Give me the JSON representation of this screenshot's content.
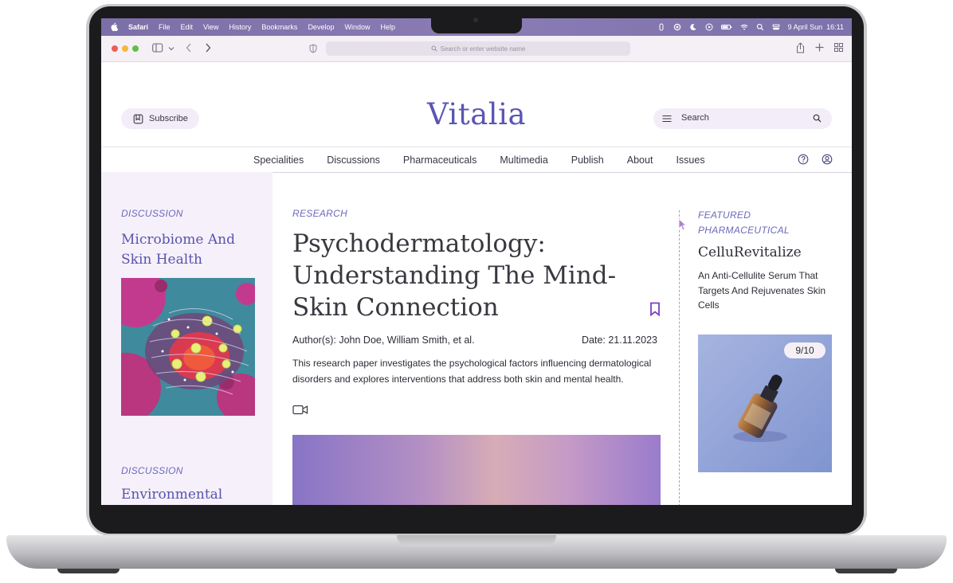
{
  "menubar": {
    "app": "Safari",
    "items": [
      "File",
      "Edit",
      "View",
      "History",
      "Bookmarks",
      "Develop",
      "Window",
      "Help"
    ],
    "datetime": "9 April Sun  16:11"
  },
  "toolbar": {
    "url_placeholder": "Search or enter website name"
  },
  "site": {
    "subscribe_label": "Subscribe",
    "logo": "Vitalia",
    "search_placeholder": "Search"
  },
  "nav": {
    "items": [
      "Specialities",
      "Discussions",
      "Pharmaceuticals",
      "Multimedia",
      "Publish",
      "About",
      "Issues"
    ]
  },
  "left": {
    "card1": {
      "category": "DISCUSSION",
      "title_line1": "Microbiome And",
      "title_line2": "Skin Health"
    },
    "card2": {
      "category": "DISCUSSION",
      "title": "Environmental"
    }
  },
  "article": {
    "category": "RESEARCH",
    "title_line1": "Psychodermatology:",
    "title_line2": "Understanding The Mind-",
    "title_line3": "Skin Connection",
    "authors": "Author(s): John Doe, William Smith, et al.",
    "date": "Date: 21.11.2023",
    "summary": "This research paper investigates the psychological factors influencing dermatological disorders and explores interventions that address both skin and mental health."
  },
  "featured": {
    "category_line1": "FEATURED",
    "category_line2": "PHARMACEUTICAL",
    "name": "CelluRevitalize",
    "description": "An Anti-Cellulite Serum That Targets And Rejuvenates Skin Cells",
    "rating": "9/10"
  },
  "colors": {
    "accent": "#5b56b3",
    "left_panel_bg": "#f6f0fb",
    "menubar": "#8579b0"
  }
}
